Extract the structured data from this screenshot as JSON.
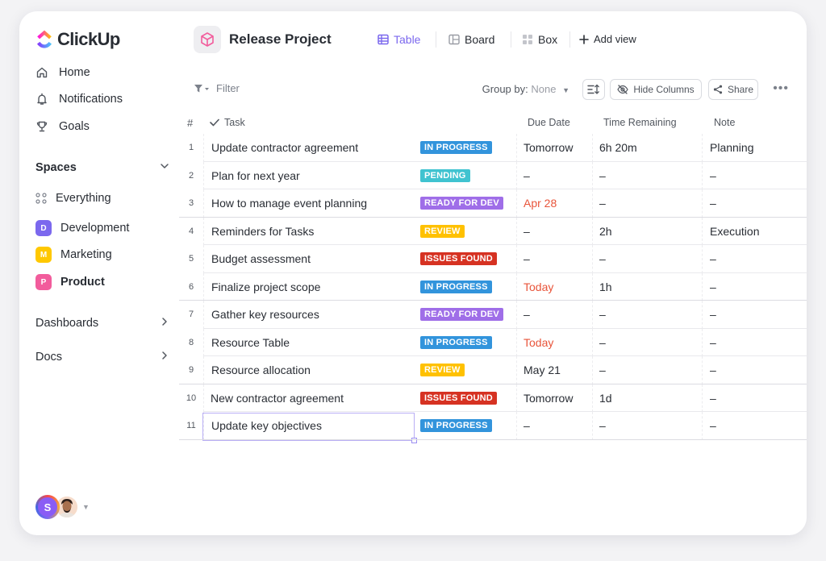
{
  "app": {
    "name": "ClickUp"
  },
  "sidebar": {
    "nav": [
      {
        "label": "Home",
        "icon": "home-icon"
      },
      {
        "label": "Notifications",
        "icon": "bell-icon"
      },
      {
        "label": "Goals",
        "icon": "trophy-icon"
      }
    ],
    "spaces_label": "Spaces",
    "everything_label": "Everything",
    "spaces": [
      {
        "label": "Development",
        "letter": "D",
        "color": "#7b68ee",
        "active": false
      },
      {
        "label": "Marketing",
        "letter": "M",
        "color": "#ffc800",
        "active": false
      },
      {
        "label": "Product",
        "letter": "P",
        "color": "#f25c9c",
        "active": true
      }
    ],
    "dashboards_label": "Dashboards",
    "docs_label": "Docs",
    "user_initial": "S"
  },
  "header": {
    "project_title": "Release Project",
    "views": [
      {
        "label": "Table",
        "icon": "table-icon",
        "active": true
      },
      {
        "label": "Board",
        "icon": "board-icon",
        "active": false
      },
      {
        "label": "Box",
        "icon": "box-icon",
        "active": false
      }
    ],
    "add_view_label": "Add view"
  },
  "toolbar": {
    "filter_label": "Filter",
    "group_by_label": "Group by:",
    "group_by_value": "None",
    "hide_columns_label": "Hide Columns",
    "share_label": "Share",
    "more_label": "•••"
  },
  "table": {
    "columns": {
      "num": "#",
      "task": "Task",
      "due": "Due Date",
      "time": "Time Remaining",
      "note": "Note"
    },
    "rows": [
      {
        "num": "1",
        "task": "Update contractor agreement",
        "status": "IN PROGRESS",
        "status_color": "#3294dc",
        "due": "Tomorrow",
        "due_red": false,
        "time": "6h 20m",
        "note": "Planning"
      },
      {
        "num": "2",
        "task": "Plan for next year",
        "status": "PENDING",
        "status_color": "#40c3d0",
        "due": "–",
        "due_red": false,
        "time": "–",
        "note": "–"
      },
      {
        "num": "3",
        "task": "How to manage event planning",
        "status": "READY FOR DEV",
        "status_color": "#9f6ee8",
        "due": "Apr 28",
        "due_red": true,
        "time": "–",
        "note": "–"
      },
      {
        "num": "4",
        "task": "Reminders for Tasks",
        "status": "REVIEW",
        "status_color": "#ffc100",
        "due": "–",
        "due_red": false,
        "time": "2h",
        "note": "Execution"
      },
      {
        "num": "5",
        "task": "Budget assessment",
        "status": "ISSUES FOUND",
        "status_color": "#d63222",
        "due": "–",
        "due_red": false,
        "time": "–",
        "note": "–"
      },
      {
        "num": "6",
        "task": "Finalize project scope",
        "status": "IN PROGRESS",
        "status_color": "#3294dc",
        "due": "Today",
        "due_red": true,
        "time": "1h",
        "note": "–"
      },
      {
        "num": "7",
        "task": "Gather key resources",
        "status": "READY FOR DEV",
        "status_color": "#9f6ee8",
        "due": "–",
        "due_red": false,
        "time": "–",
        "note": "–"
      },
      {
        "num": "8",
        "task": "Resource Table",
        "status": "IN PROGRESS",
        "status_color": "#3294dc",
        "due": "Today",
        "due_red": true,
        "time": "–",
        "note": "–"
      },
      {
        "num": "9",
        "task": "Resource allocation",
        "status": "REVIEW",
        "status_color": "#ffc100",
        "due": "May 21",
        "due_red": false,
        "time": "–",
        "note": "–"
      },
      {
        "num": "10",
        "task": "New contractor agreement",
        "status": "ISSUES FOUND",
        "status_color": "#d63222",
        "due": "Tomorrow",
        "due_red": false,
        "time": "1d",
        "note": "–"
      },
      {
        "num": "11",
        "task": "Update key objectives",
        "status": "IN PROGRESS",
        "status_color": "#3294dc",
        "due": "–",
        "due_red": false,
        "time": "–",
        "note": "–"
      }
    ]
  }
}
